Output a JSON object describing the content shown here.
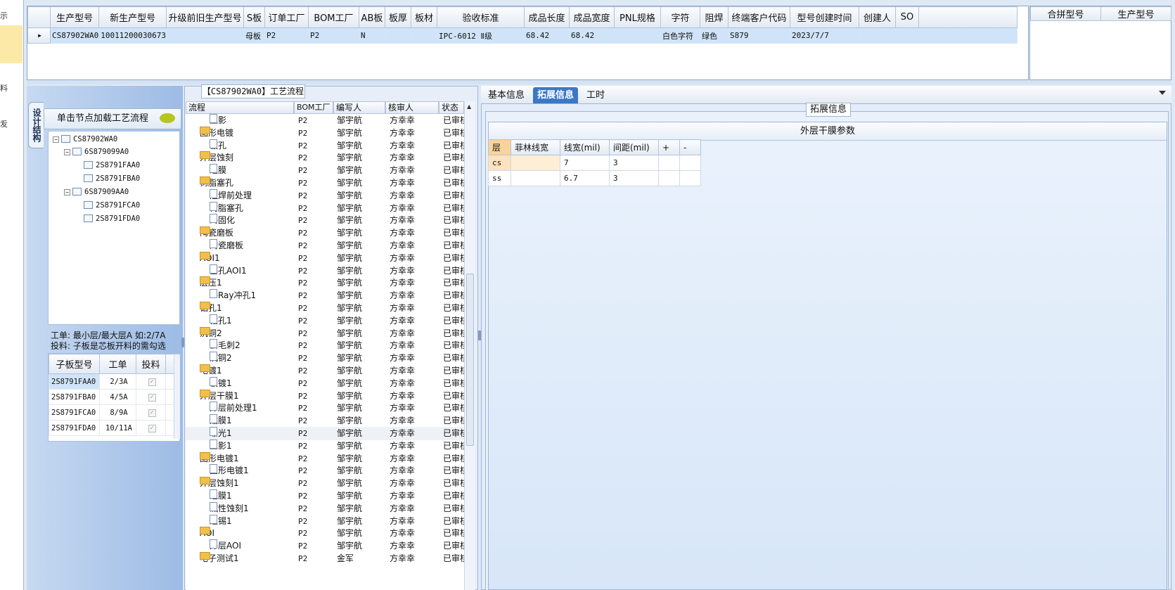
{
  "left_strip": {
    "items": [
      "示",
      "料",
      "叐"
    ]
  },
  "top_grid": {
    "columns": [
      "生产型号",
      "新生产型号",
      "升级前旧生产型号",
      "S板",
      "订单工厂",
      "BOM工厂",
      "AB板",
      "板厚",
      "板材",
      "验收标准",
      "成品长度",
      "成品宽度",
      "PNL规格",
      "字符",
      "阻焊",
      "终端客户代码",
      "型号创建时间",
      "创建人",
      "SO"
    ],
    "row": [
      "CS87902WA0",
      "10011200030673",
      "",
      "母板",
      "P2",
      "P2",
      "N",
      "",
      "",
      "IPC-6012 Ⅱ级",
      "68.42",
      "68.42",
      "",
      "白色字符",
      "绿色",
      "S879",
      "2023/7/7",
      "",
      ""
    ]
  },
  "merge_grid": {
    "columns": [
      "合拼型号",
      "生产型号"
    ]
  },
  "left_nav": {
    "vertical_tab": "设计结构",
    "load_label": "单击节点加载工艺流程",
    "tree": [
      {
        "label": "CS87902WA0",
        "level": 0
      },
      {
        "label": "6S879099A0",
        "level": 1
      },
      {
        "label": "2S8791FAA0",
        "level": 2
      },
      {
        "label": "2S8791FBA0",
        "level": 2
      },
      {
        "label": "6S87909AA0",
        "level": 1
      },
      {
        "label": "2S8791FCA0",
        "level": 2
      },
      {
        "label": "2S8791FDA0",
        "level": 2
      }
    ],
    "info_line1": "工单: 最小层/最大层A 如:2/7A",
    "info_line2": "投料: 子板是芯板开料的需勾选",
    "sub_columns": [
      "子板型号",
      "工单",
      "投料"
    ],
    "sub_rows": [
      {
        "model": "2S8791FAA0",
        "order": "2/3A",
        "feed": "✓"
      },
      {
        "model": "2S8791FBA0",
        "order": "4/5A",
        "feed": "✓"
      },
      {
        "model": "2S8791FCA0",
        "order": "8/9A",
        "feed": "✓"
      },
      {
        "model": "2S8791FDA0",
        "order": "10/11A",
        "feed": "✓"
      }
    ]
  },
  "process": {
    "title": "【CS87902WA0】工艺流程",
    "columns": [
      "流程",
      "BOM工厂",
      "编写人",
      "核审人",
      "状态"
    ],
    "rows": [
      {
        "name": "显影",
        "type": "doc",
        "bom": "P2",
        "writer": "邹宇航",
        "reviewer": "方幸幸",
        "status": "已审核"
      },
      {
        "name": "图形电镀",
        "type": "folder",
        "bom": "P2",
        "writer": "邹宇航",
        "reviewer": "方幸幸",
        "status": "已审核"
      },
      {
        "name": "镀孔",
        "type": "doc",
        "bom": "P2",
        "writer": "邹宇航",
        "reviewer": "方幸幸",
        "status": "已审核"
      },
      {
        "name": "外层蚀刻",
        "type": "folder",
        "bom": "P2",
        "writer": "邹宇航",
        "reviewer": "方幸幸",
        "status": "已审核"
      },
      {
        "name": "退膜",
        "type": "doc",
        "bom": "P2",
        "writer": "邹宇航",
        "reviewer": "方幸幸",
        "status": "已审核"
      },
      {
        "name": "树脂塞孔",
        "type": "folder",
        "bom": "P2",
        "writer": "邹宇航",
        "reviewer": "方幸幸",
        "status": "已审核"
      },
      {
        "name": "阻焊前处理",
        "type": "doc",
        "bom": "P2",
        "writer": "邹宇航",
        "reviewer": "方幸幸",
        "status": "已审核"
      },
      {
        "name": "树脂塞孔",
        "type": "doc",
        "bom": "P2",
        "writer": "邹宇航",
        "reviewer": "方幸幸",
        "status": "已审核"
      },
      {
        "name": "终固化",
        "type": "doc",
        "bom": "P2",
        "writer": "邹宇航",
        "reviewer": "方幸幸",
        "status": "已审核"
      },
      {
        "name": "陶瓷磨板",
        "type": "folder",
        "bom": "P2",
        "writer": "邹宇航",
        "reviewer": "方幸幸",
        "status": "已审核"
      },
      {
        "name": "陶瓷磨板",
        "type": "doc",
        "bom": "P2",
        "writer": "邹宇航",
        "reviewer": "方幸幸",
        "status": "已审核"
      },
      {
        "name": "AOI1",
        "type": "folder",
        "bom": "P2",
        "writer": "邹宇航",
        "reviewer": "方幸幸",
        "status": "已审核"
      },
      {
        "name": "塞孔AOI1",
        "type": "doc",
        "bom": "P2",
        "writer": "邹宇航",
        "reviewer": "方幸幸",
        "status": "已审核"
      },
      {
        "name": "层压1",
        "type": "folder",
        "bom": "P2",
        "writer": "邹宇航",
        "reviewer": "方幸幸",
        "status": "已审核"
      },
      {
        "name": "X-Ray冲孔1",
        "type": "doc",
        "bom": "P2",
        "writer": "邹宇航",
        "reviewer": "方幸幸",
        "status": "已审核"
      },
      {
        "name": "钻孔1",
        "type": "folder",
        "bom": "P2",
        "writer": "邹宇航",
        "reviewer": "方幸幸",
        "status": "已审核"
      },
      {
        "name": "钻孔1",
        "type": "doc",
        "bom": "P2",
        "writer": "邹宇航",
        "reviewer": "方幸幸",
        "status": "已审核"
      },
      {
        "name": "沉铜2",
        "type": "folder",
        "bom": "P2",
        "writer": "邹宇航",
        "reviewer": "方幸幸",
        "status": "已审核"
      },
      {
        "name": "去毛刺2",
        "type": "doc",
        "bom": "P2",
        "writer": "邹宇航",
        "reviewer": "方幸幸",
        "status": "已审核"
      },
      {
        "name": "沉铜2",
        "type": "doc",
        "bom": "P2",
        "writer": "邹宇航",
        "reviewer": "方幸幸",
        "status": "已审核"
      },
      {
        "name": "电镀1",
        "type": "folder",
        "bom": "P2",
        "writer": "邹宇航",
        "reviewer": "方幸幸",
        "status": "已审核"
      },
      {
        "name": "板镀1",
        "type": "doc",
        "bom": "P2",
        "writer": "邹宇航",
        "reviewer": "方幸幸",
        "status": "已审核"
      },
      {
        "name": "外层干膜1",
        "type": "folder",
        "bom": "P2",
        "writer": "邹宇航",
        "reviewer": "方幸幸",
        "status": "已审核"
      },
      {
        "name": "外层前处理1",
        "type": "doc",
        "bom": "P2",
        "writer": "邹宇航",
        "reviewer": "方幸幸",
        "status": "已审核"
      },
      {
        "name": "贴膜1",
        "type": "doc",
        "bom": "P2",
        "writer": "邹宇航",
        "reviewer": "方幸幸",
        "status": "已审核"
      },
      {
        "name": "曝光1",
        "type": "doc",
        "bom": "P2",
        "writer": "邹宇航",
        "reviewer": "方幸幸",
        "status": "已审核",
        "selected": true
      },
      {
        "name": "显影1",
        "type": "doc",
        "bom": "P2",
        "writer": "邹宇航",
        "reviewer": "方幸幸",
        "status": "已审核"
      },
      {
        "name": "图形电镀1",
        "type": "folder",
        "bom": "P2",
        "writer": "邹宇航",
        "reviewer": "方幸幸",
        "status": "已审核"
      },
      {
        "name": "图形电镀1",
        "type": "doc",
        "bom": "P2",
        "writer": "邹宇航",
        "reviewer": "方幸幸",
        "status": "已审核"
      },
      {
        "name": "外层蚀刻1",
        "type": "folder",
        "bom": "P2",
        "writer": "邹宇航",
        "reviewer": "方幸幸",
        "status": "已审核"
      },
      {
        "name": "退膜1",
        "type": "doc",
        "bom": "P2",
        "writer": "邹宇航",
        "reviewer": "方幸幸",
        "status": "已审核"
      },
      {
        "name": "碱性蚀刻1",
        "type": "doc",
        "bom": "P2",
        "writer": "邹宇航",
        "reviewer": "方幸幸",
        "status": "已审核"
      },
      {
        "name": "退锡1",
        "type": "doc",
        "bom": "P2",
        "writer": "邹宇航",
        "reviewer": "方幸幸",
        "status": "已审核"
      },
      {
        "name": "AOI",
        "type": "folder",
        "bom": "P2",
        "writer": "邹宇航",
        "reviewer": "方幸幸",
        "status": "已审核"
      },
      {
        "name": "外层AOI",
        "type": "doc",
        "bom": "P2",
        "writer": "邹宇航",
        "reviewer": "方幸幸",
        "status": "已审核"
      },
      {
        "name": "电子测试1",
        "type": "folder",
        "bom": "P2",
        "writer": "金军",
        "reviewer": "方幸幸",
        "status": "已审核"
      }
    ]
  },
  "right": {
    "tabs": [
      "基本信息",
      "拓展信息",
      "工时"
    ],
    "active_tab": "拓展信息",
    "section_title": "拓展信息",
    "params_title": "外层干膜参数",
    "param_columns": [
      "层",
      "菲林线宽",
      "线宽(mil)",
      "间距(mil)",
      "+",
      "-"
    ],
    "param_rows": [
      {
        "layer": "cs",
        "film": "",
        "width": "7",
        "gap": "3"
      },
      {
        "layer": "ss",
        "film": "",
        "width": "6.7",
        "gap": "3"
      }
    ]
  },
  "colors": {
    "accent": "#3c77c5",
    "selected_row": "#cfe4f8",
    "panel_bg": "#dfe9f6",
    "layer_header": "#f8d39b"
  }
}
